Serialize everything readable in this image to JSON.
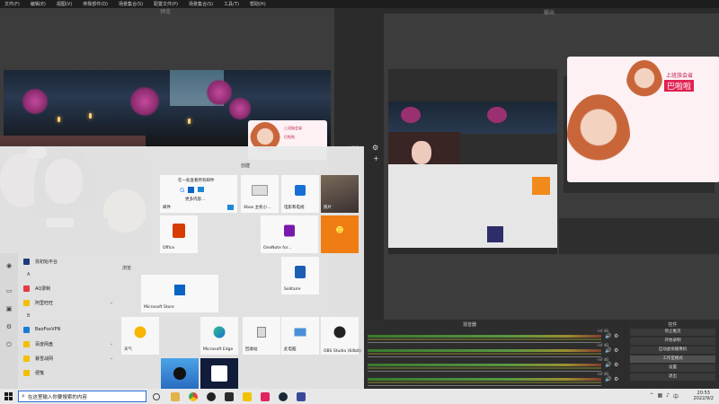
{
  "menubar": {
    "items": [
      "文件(F)",
      "编辑(E)",
      "视图(V)",
      "停靠部件(D)",
      "场景集合(S)",
      "配置文件(P)",
      "场景集合(S)",
      "工具(T)",
      "帮助(H)"
    ]
  },
  "preview": {
    "title": "预览"
  },
  "program": {
    "title": "输出"
  },
  "studio_mode": {
    "label": "工作室模式"
  },
  "start_menu": {
    "group_create": "创建",
    "group_browse": "浏览",
    "sidebar_icons": [
      "user-icon",
      "document-icon",
      "picture-icon",
      "settings-icon",
      "power-icon"
    ],
    "app_list": [
      {
        "label": "找初始平台",
        "type": "item"
      },
      {
        "label": "A",
        "type": "letter"
      },
      {
        "label": "AQ录制",
        "type": "item"
      },
      {
        "label": "阿里旺旺",
        "type": "folder"
      },
      {
        "label": "B",
        "type": "letter"
      },
      {
        "label": "BaoFoxVPN",
        "type": "item"
      },
      {
        "label": "百度网盘",
        "type": "folder"
      },
      {
        "label": "暴雪战网",
        "type": "folder"
      },
      {
        "label": "便笺",
        "type": "item"
      }
    ],
    "tiles": {
      "mail": "邮件",
      "mail_line1": "在一处查看所有邮件",
      "mail_line2": "更多内容...",
      "office": "Office",
      "xbox": "Xbox 主机小...",
      "movies": "电影和电视",
      "photos": "照片",
      "onenote": "OneNote for...",
      "solitaire": "Solitaire",
      "store": "Microsoft Store",
      "weather": "天气",
      "edge": "Microsoft Edge",
      "recycle": "回收站",
      "thispc": "此电脑",
      "obs": "OBS Studio (64bit)"
    }
  },
  "anime_card": {
    "line1": "上班族会省",
    "line2": "巴啦啦"
  },
  "mixer": {
    "title": "混音器",
    "tracks": [
      {
        "name": "-inf dB",
        "vol": "🔊",
        "gear": "⚙"
      },
      {
        "name": "-inf dB",
        "vol": "🔊",
        "gear": "⚙"
      },
      {
        "name": "-inf dB",
        "vol": "🔊",
        "gear": "⚙"
      },
      {
        "name": "-inf dB",
        "vol": "🔊",
        "gear": "⚙"
      }
    ]
  },
  "controls": {
    "title": "控件",
    "buttons": [
      "停止推流",
      "开始录制",
      "启动虚拟摄像机",
      "工作室模式",
      "设置",
      "退出"
    ]
  },
  "taskbar": {
    "search_placeholder": "在这里输入你要搜索的内容",
    "time": "20:53",
    "date": "2022/9/2"
  }
}
